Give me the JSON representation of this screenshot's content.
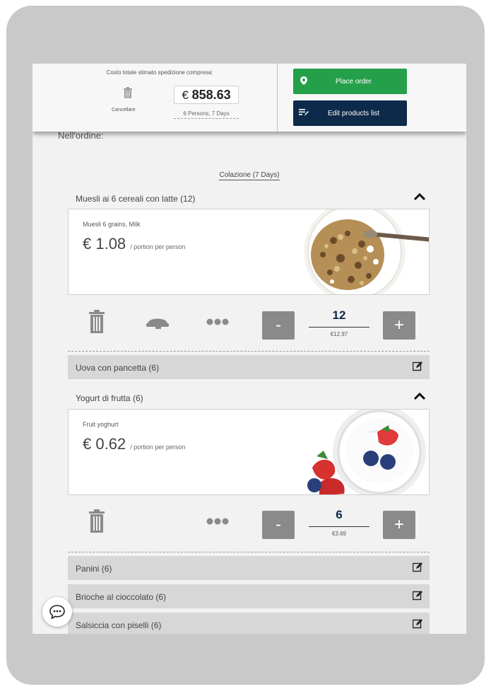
{
  "header": {
    "cost_label": "Costo totale stimato spedizione compresa:",
    "cancel_label": "Cancellare",
    "total_currency": "€",
    "total_value": "858.63",
    "persons_days": "6 Persons, 7 Days",
    "place_order": "Place order",
    "edit_products": "Edit products list"
  },
  "behind_text": "Nell'ordine:",
  "section": {
    "title": "Colazione (7 Days)"
  },
  "items": [
    {
      "title": "Muesli ai 6 cereali con latte (12)",
      "description": "Muesli 6 grains, Milk",
      "price": "€ 1.08",
      "price_unit": "/ portion per person",
      "quantity": "12",
      "subtotal": "€12.97"
    },
    {
      "title": "Yogurt di frutta (6)",
      "description": "Fruit yoghurt",
      "price": "€ 0.62",
      "price_unit": "/ portion per person",
      "quantity": "6",
      "subtotal": "€3.69"
    }
  ],
  "collapsed": [
    {
      "title": "Uova con pancetta (6)"
    },
    {
      "title": "Panini (6)"
    },
    {
      "title": "Brioche al cioccolato (6)"
    },
    {
      "title": "Salsiccia con piselli (6)"
    }
  ],
  "controls": {
    "minus": "-",
    "plus": "+"
  },
  "colors": {
    "green": "#24a04a",
    "navy": "#0e2a4a",
    "gray_button": "#8a8a8a"
  }
}
